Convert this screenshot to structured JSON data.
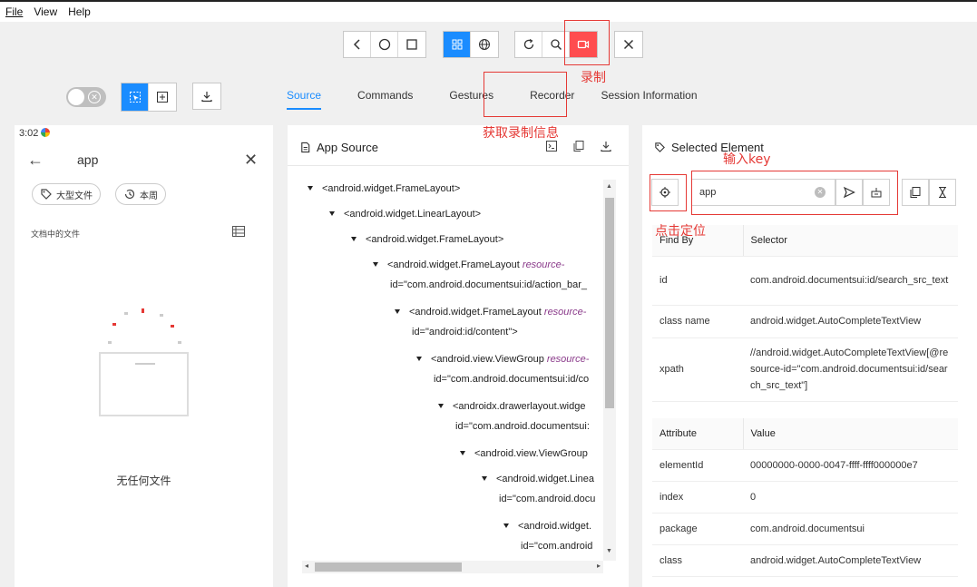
{
  "menu": [
    "File",
    "View",
    "Help"
  ],
  "toolbar": {
    "nav_icons": [
      "back-icon",
      "home-icon",
      "square-icon"
    ],
    "view_icons": [
      "grid-icon",
      "globe-icon"
    ],
    "action_icons": [
      "refresh-icon",
      "search-icon",
      "record-icon"
    ],
    "close_icon": "close-icon"
  },
  "tabs": [
    "Source",
    "Commands",
    "Gestures",
    "Recorder",
    "Session Information"
  ],
  "phone": {
    "time": "3:02",
    "query": "app",
    "chip1": "大型文件",
    "chip2": "本周",
    "section": "文档中的文件",
    "empty": "无任何文件"
  },
  "source": {
    "title": "App Source",
    "nodes": [
      {
        "text": "<android.widget.FrameLayout>",
        "attr": "",
        "cont": ""
      },
      {
        "text": "<android.widget.LinearLayout>",
        "attr": "",
        "cont": ""
      },
      {
        "text": "<android.widget.FrameLayout>",
        "attr": "",
        "cont": ""
      },
      {
        "text": "<android.widget.FrameLayout ",
        "attr": "resource-",
        "cont": "id=\"com.android.documentsui:id/action_bar_"
      },
      {
        "text": "<android.widget.FrameLayout ",
        "attr": "resource-",
        "cont": "id=\"android:id/content\">"
      },
      {
        "text": "<android.view.ViewGroup ",
        "attr": "resource-",
        "cont": "id=\"com.android.documentsui:id/co"
      },
      {
        "text": "<androidx.drawerlayout.widge",
        "attr": "",
        "cont": "id=\"com.android.documentsui:"
      },
      {
        "text": "<android.view.ViewGroup",
        "attr": "",
        "cont": ""
      },
      {
        "text": "<android.widget.Linea",
        "attr": "",
        "cont": "id=\"com.android.docu"
      },
      {
        "text": "<android.widget.",
        "attr": "",
        "cont": "id=\"com.android"
      }
    ]
  },
  "selected": {
    "title": "Selected Element",
    "search_value": "app",
    "find_headers": [
      "Find By",
      "Selector"
    ],
    "find_rows": [
      {
        "k": "id",
        "v": "com.android.documentsui:id/search_src_text"
      },
      {
        "k": "class name",
        "v": "android.widget.AutoCompleteTextView"
      },
      {
        "k": "xpath",
        "v": "//android.widget.AutoCompleteTextView[@resource-id=\"com.android.documentsui:id/search_src_text\"]"
      }
    ],
    "attr_headers": [
      "Attribute",
      "Value"
    ],
    "attr_rows": [
      {
        "k": "elementId",
        "v": "00000000-0000-0047-ffff-ffff000000e7"
      },
      {
        "k": "index",
        "v": "0"
      },
      {
        "k": "package",
        "v": "com.android.documentsui"
      },
      {
        "k": "class",
        "v": "android.widget.AutoCompleteTextView"
      }
    ]
  },
  "annotations": {
    "record": "录制",
    "recorder_info": "获取录制信息",
    "input_key": "输入key",
    "locate": "点击定位"
  },
  "colors": {
    "accent": "#1a8cff",
    "record": "#ff4d4f",
    "annotation": "#e53935"
  }
}
